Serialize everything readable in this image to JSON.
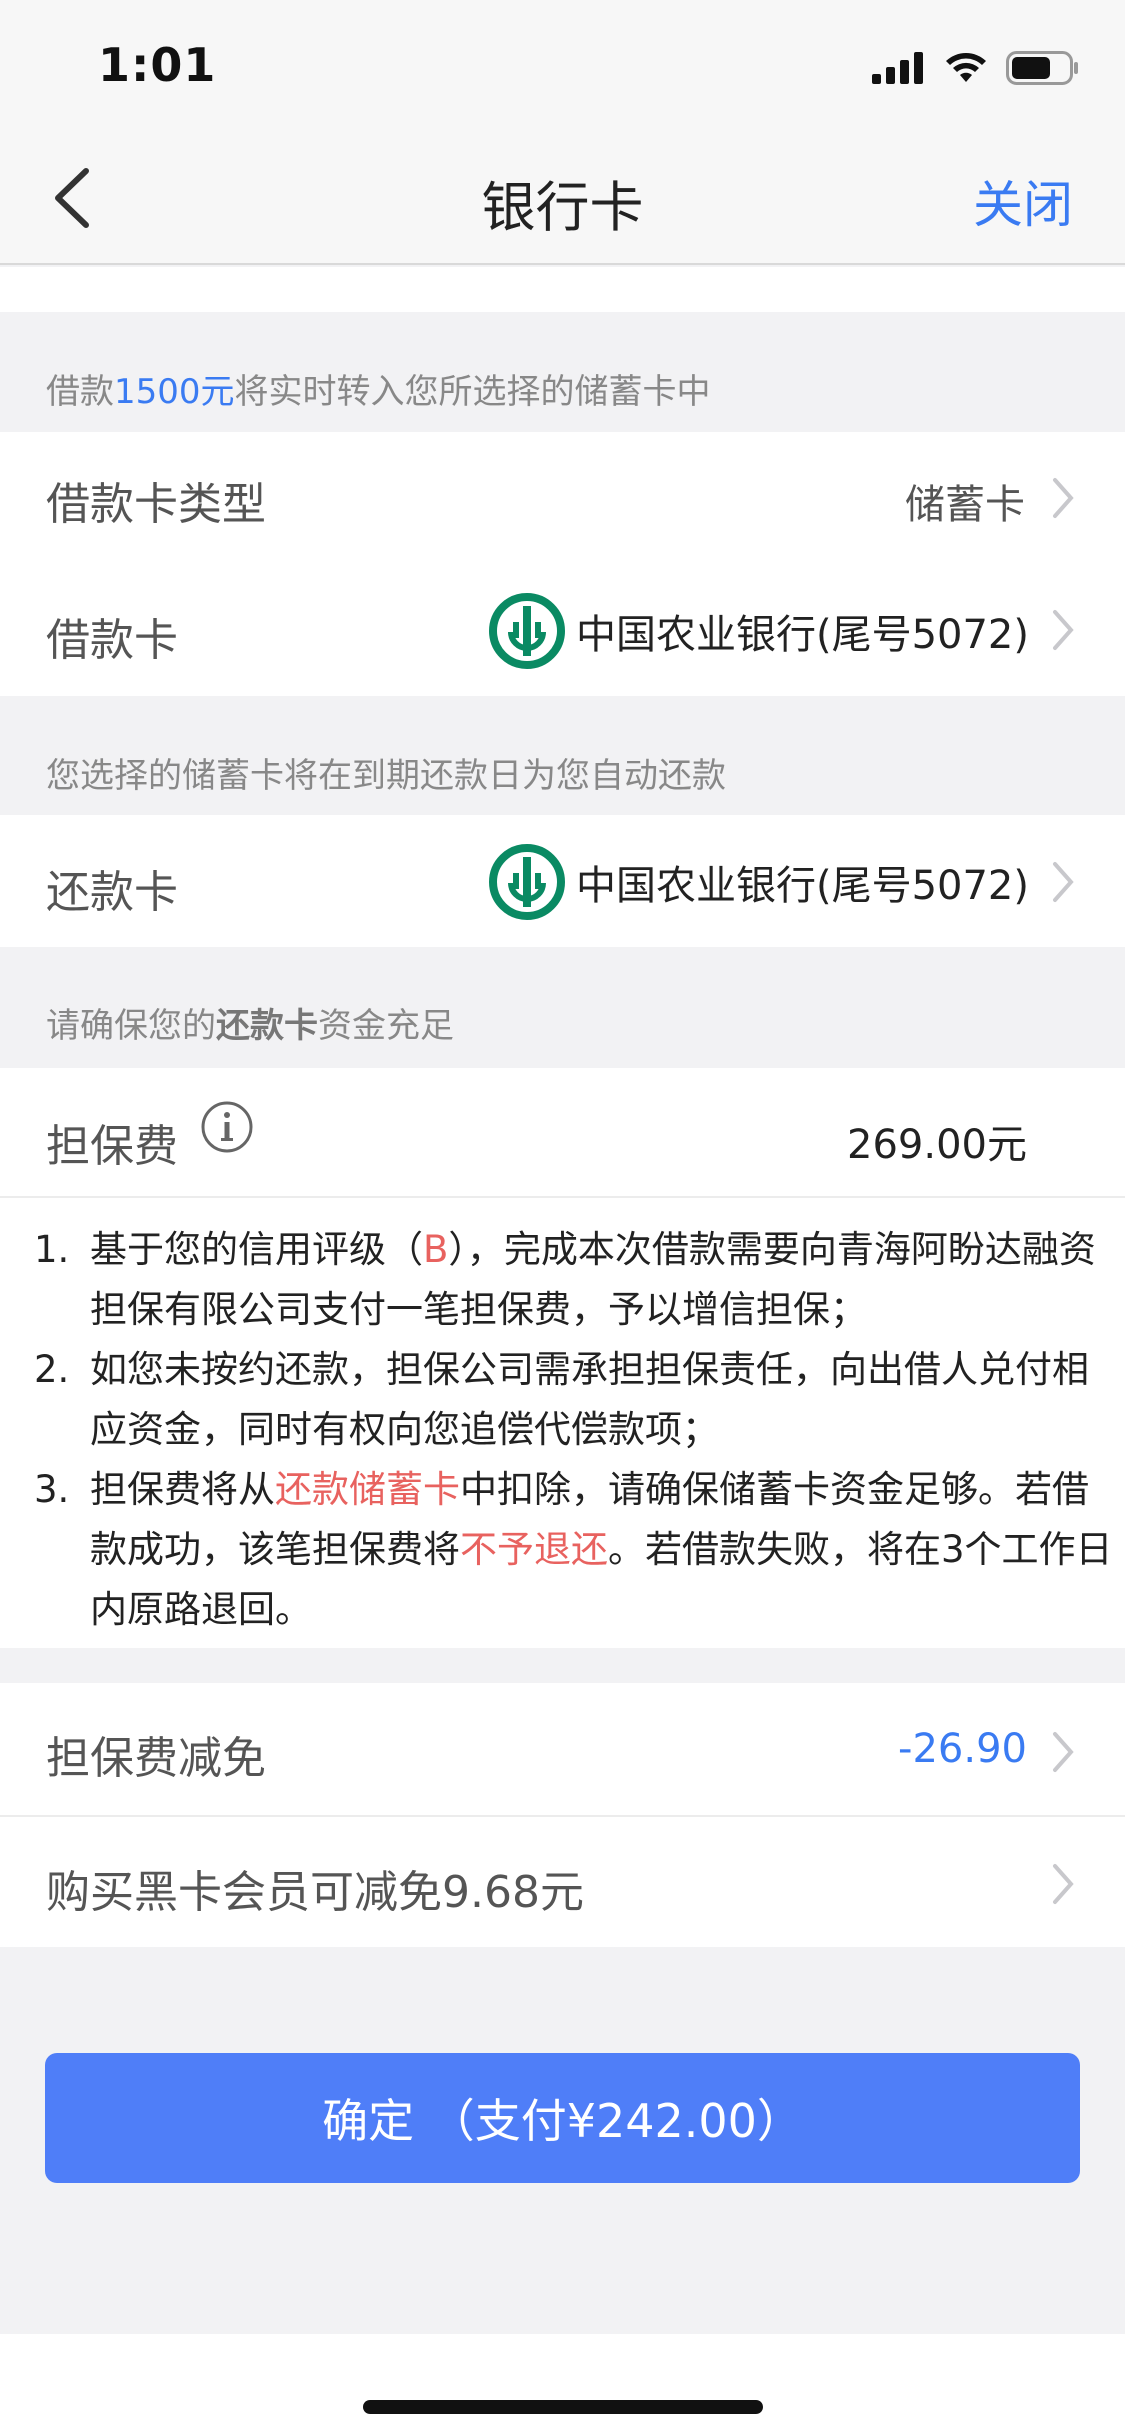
{
  "status_bar": {
    "time": "1:01"
  },
  "nav": {
    "title": "银行卡",
    "close_label": "关闭"
  },
  "transfer_note": {
    "prefix": "借款",
    "amount": "1500元",
    "suffix": "将实时转入您所选择的储蓄卡中"
  },
  "loan_card_type": {
    "label": "借款卡类型",
    "value": "储蓄卡"
  },
  "loan_card": {
    "label": "借款卡",
    "value": "中国农业银行(尾号5072)"
  },
  "auto_repay_note": "您选择的储蓄卡将在到期还款日为您自动还款",
  "repay_card": {
    "label": "还款卡",
    "value": "中国农业银行(尾号5072)"
  },
  "fund_note": {
    "prefix": "请确保您的",
    "bold": "还款卡",
    "suffix": "资金充足"
  },
  "guarantee_fee": {
    "label": "担保费",
    "value": "269.00元"
  },
  "terms": {
    "item1": {
      "num": "1.",
      "a": "基于您的信用评级（",
      "grade": "B",
      "b": "），完成本次借款需要向青海阿盼达融资担保有限公司支付一笔担保费，予以增信担保；"
    },
    "item2": {
      "num": "2.",
      "text": "如您未按约还款，担保公司需承担担保责任，向出借人兑付相应资金，同时有权向您追偿代偿款项；"
    },
    "item3": {
      "num": "3.",
      "a": "担保费将从",
      "red1": "还款储蓄卡",
      "b": "中扣除，请确保储蓄卡资金足够。若借款成功，该笔担保费将",
      "red2": "不予退还",
      "c": "。若借款失败，将在3个工作日内原路退回。"
    }
  },
  "fee_discount": {
    "label": "担保费减免",
    "value": "-26.90"
  },
  "black_card": {
    "label": "购买黑卡会员可减免9.68元"
  },
  "confirm_button": {
    "label": "确定  （支付¥242.00）"
  },
  "colors": {
    "accent": "#3a7bf2",
    "button": "#4f7ef8",
    "warning": "#e8625f",
    "bank_logo": "#0a8a63"
  }
}
